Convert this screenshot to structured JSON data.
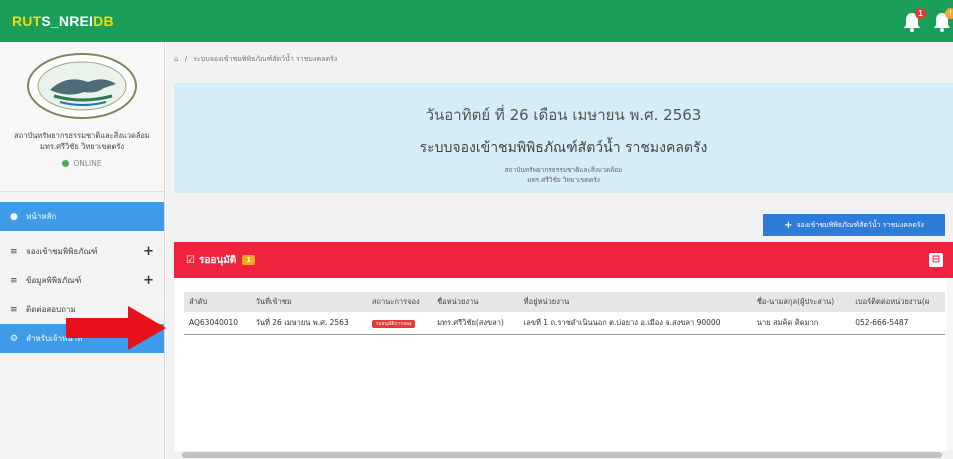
{
  "topbar": {
    "brand_part1": "RUT",
    "brand_part2": "S_NREI",
    "brand_part3": "DB",
    "bell1_badge": "1",
    "bell2_badge": "!",
    "colors": {
      "bar": "#1a9e58",
      "brand_yellow": "#f5d90a"
    }
  },
  "sidebar": {
    "org_line1": "สถาบันทรัพยากรธรรมชาติและสิ่งแวดล้อม",
    "org_line2": "มทร.ศรีวิชัย วิทยาเขตตรัง",
    "status": "ONLINE",
    "items": [
      {
        "label": "หน้าหลัก",
        "icon": "dashboard-icon"
      },
      {
        "label": "จองเข้าชมพิพิธภัณฑ์",
        "icon": "menu-icon"
      },
      {
        "label": "ข้อมูลพิพิธภัณฑ์",
        "icon": "menu-icon"
      },
      {
        "label": "ติดต่อสอบถาม",
        "icon": "menu-icon"
      },
      {
        "label": "สำหรับเจ้าหน้าที่",
        "icon": "settings-icon"
      }
    ]
  },
  "breadcrumb": {
    "text": "ระบบจองเข้าชมพิพิธภัณฑ์สัตว์น้ำ ราชมงคลตรัง"
  },
  "header": {
    "date": "วันอาทิตย์ ที่ 26 เดือน เมษายน พ.ศ. 2563",
    "title": "ระบบจองเข้าชมพิพิธภัณฑ์สัตว์น้ำ ราชมงคลตรัง",
    "sub1": "สถาบันทรัพยากรธรรมชาติและสิ่งแวดล้อม",
    "sub2": "มทร.ศรีวิชัย วิทยาเขตตรัง"
  },
  "book_button": "จองเข้าชมพิพิธภัณฑ์สัตว์น้ำ ราชมงคลตรัง",
  "panel": {
    "title": "รออนุมัติ",
    "count": "1"
  },
  "table": {
    "headers": [
      "ลำดับ",
      "วันที่เข้าชม",
      "สถานะการจอง",
      "ชื่อหน่วยงาน",
      "ที่อยู่หน่วยงาน",
      "ชื่อ-นามสกุล(ผู้ประสาน)",
      "เบอร์ติดต่อหน่วยงาน(ผ"
    ],
    "rows": [
      [
        "AQ63040010",
        "วันที่ 26 เมษายน พ.ศ. 2563",
        "รออนุมัติการจอง",
        "มทร.ศรีวิชัย(สงขลา)",
        "เลขที่ 1 ถ.ราชดำเนินนอก ต.บ่อยาง อ.เมือง จ.สงขลา 90000",
        "นาย สมคิด คิดมาก",
        "052-666-5487"
      ]
    ]
  }
}
